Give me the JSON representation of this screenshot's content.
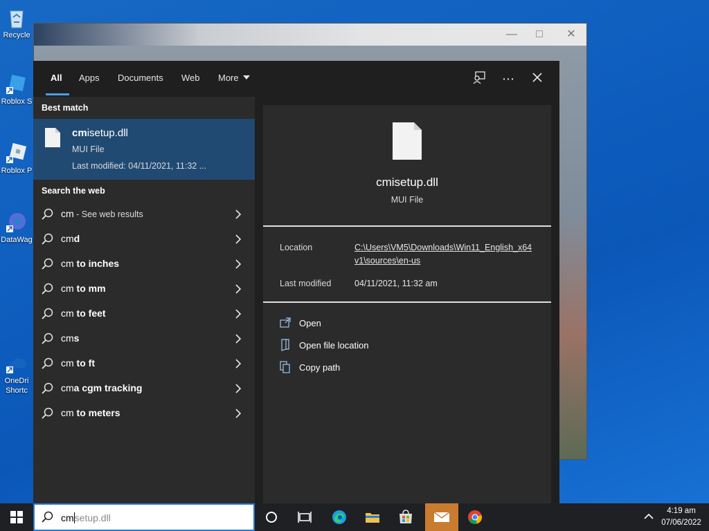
{
  "desktop": {
    "icons": [
      {
        "name": "recycle-bin",
        "label": "Recycle"
      },
      {
        "name": "roblox-studio",
        "label": "Roblox S"
      },
      {
        "name": "roblox-player",
        "label": "Roblox P"
      },
      {
        "name": "datawag",
        "label": "DataWag"
      },
      {
        "name": "onedrive",
        "label1": "OneDri",
        "label2": "Shortc"
      }
    ]
  },
  "search": {
    "tabs": [
      {
        "label": "All",
        "active": true
      },
      {
        "label": "Apps"
      },
      {
        "label": "Documents"
      },
      {
        "label": "Web"
      },
      {
        "label": "More"
      }
    ],
    "best_match": {
      "heading": "Best match",
      "name_bold": "cm",
      "name_rest": "isetup.dll",
      "type": "MUI File",
      "modified": "Last modified: 04/11/2021, 11:32 ..."
    },
    "web": {
      "heading": "Search the web",
      "results": [
        {
          "q": "cm",
          "rest": "",
          "hint": " - See web results"
        },
        {
          "q": "cm",
          "rest": "d",
          "hint": ""
        },
        {
          "q": "cm",
          "rest": " to inches",
          "hint": ""
        },
        {
          "q": "cm",
          "rest": " to mm",
          "hint": ""
        },
        {
          "q": "cm",
          "rest": " to feet",
          "hint": ""
        },
        {
          "q": "cm",
          "rest": "s",
          "hint": ""
        },
        {
          "q": "cm",
          "rest": " to ft",
          "hint": ""
        },
        {
          "q": "cm",
          "rest": "a cgm tracking",
          "hint": ""
        },
        {
          "q": "cm",
          "rest": " to meters",
          "hint": ""
        }
      ]
    },
    "preview": {
      "name": "cmisetup.dll",
      "type": "MUI File",
      "location_label": "Location",
      "location_value": "C:\\Users\\VM5\\Downloads\\Win11_English_x64v1\\sources\\en-us",
      "modified_label": "Last modified",
      "modified_value": "04/11/2021, 11:32 am",
      "actions": [
        {
          "label": "Open",
          "icon": "open-icon"
        },
        {
          "label": "Open file location",
          "icon": "file-location-icon"
        },
        {
          "label": "Copy path",
          "icon": "copy-path-icon"
        }
      ]
    }
  },
  "taskbar": {
    "search_typed": "cm",
    "search_suggest": "setup.dll",
    "time": "4:19 am",
    "date": "07/06/2022"
  },
  "colors": {
    "accent": "#4f9be8",
    "selected": "#214a73",
    "panel": "#2b2b2b",
    "taskbar_active": "#c97b2f"
  }
}
